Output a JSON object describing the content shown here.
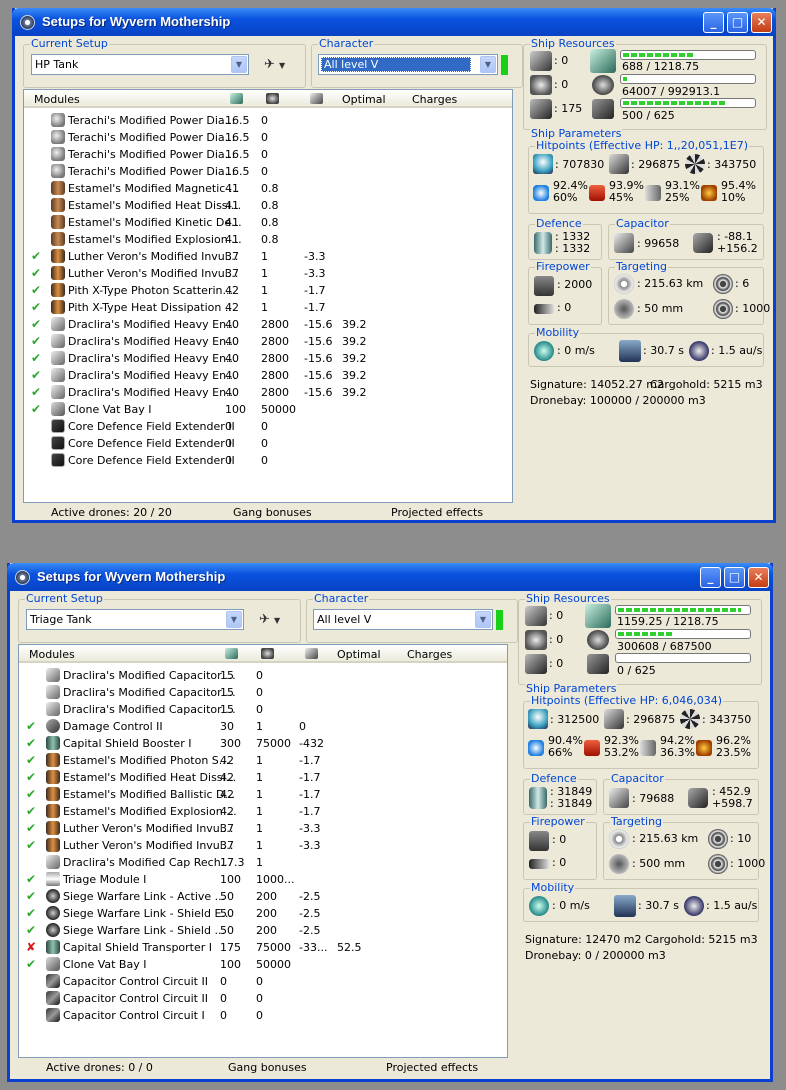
{
  "windows": [
    {
      "title": "Setups for Wyvern Mothership",
      "current_setup_label": "Current Setup",
      "current_setup": "HP Tank",
      "character_label": "Character",
      "character": "All level V",
      "character_highlight": true,
      "list_headers": {
        "modules": "Modules",
        "optimal": "Optimal",
        "charges": "Charges"
      },
      "modules": [
        {
          "check": "",
          "icon": "bay",
          "name": "Terachi's Modified Power Dia...",
          "c1": "16.5",
          "c2": "0",
          "c3": "",
          "c4": ""
        },
        {
          "check": "",
          "icon": "bay",
          "name": "Terachi's Modified Power Dia...",
          "c1": "16.5",
          "c2": "0",
          "c3": "",
          "c4": ""
        },
        {
          "check": "",
          "icon": "bay",
          "name": "Terachi's Modified Power Dia...",
          "c1": "16.5",
          "c2": "0",
          "c3": "",
          "c4": ""
        },
        {
          "check": "",
          "icon": "bay",
          "name": "Terachi's Modified Power Dia...",
          "c1": "16.5",
          "c2": "0",
          "c3": "",
          "c4": ""
        },
        {
          "check": "",
          "icon": "mag",
          "name": "Estamel's Modified Magnetic ...",
          "c1": "41",
          "c2": "0.8",
          "c3": "",
          "c4": ""
        },
        {
          "check": "",
          "icon": "mag",
          "name": "Estamel's Modified Heat Dissi...",
          "c1": "41",
          "c2": "0.8",
          "c3": "",
          "c4": ""
        },
        {
          "check": "",
          "icon": "mag",
          "name": "Estamel's Modified Kinetic De...",
          "c1": "41",
          "c2": "0.8",
          "c3": "",
          "c4": ""
        },
        {
          "check": "",
          "icon": "mag",
          "name": "Estamel's Modified Explosion ...",
          "c1": "41",
          "c2": "0.8",
          "c3": "",
          "c4": ""
        },
        {
          "check": "✔",
          "icon": "amp",
          "name": "Luther Veron's Modified Invul...",
          "c1": "37",
          "c2": "1",
          "c3": "-3.3",
          "c4": ""
        },
        {
          "check": "✔",
          "icon": "amp",
          "name": "Luther Veron's Modified Invul...",
          "c1": "37",
          "c2": "1",
          "c3": "-3.3",
          "c4": ""
        },
        {
          "check": "✔",
          "icon": "amp",
          "name": "Pith X-Type Photon Scatterin...",
          "c1": "42",
          "c2": "1",
          "c3": "-1.7",
          "c4": ""
        },
        {
          "check": "✔",
          "icon": "amp",
          "name": "Pith X-Type Heat Dissipation ...",
          "c1": "42",
          "c2": "1",
          "c3": "-1.7",
          "c4": ""
        },
        {
          "check": "✔",
          "icon": "cap",
          "name": "Draclira's Modified Heavy En...",
          "c1": "40",
          "c2": "2800",
          "c3": "-15.6",
          "c4": "39.2"
        },
        {
          "check": "✔",
          "icon": "cap",
          "name": "Draclira's Modified Heavy En...",
          "c1": "40",
          "c2": "2800",
          "c3": "-15.6",
          "c4": "39.2"
        },
        {
          "check": "✔",
          "icon": "cap",
          "name": "Draclira's Modified Heavy En...",
          "c1": "40",
          "c2": "2800",
          "c3": "-15.6",
          "c4": "39.2"
        },
        {
          "check": "✔",
          "icon": "cap",
          "name": "Draclira's Modified Heavy En...",
          "c1": "40",
          "c2": "2800",
          "c3": "-15.6",
          "c4": "39.2"
        },
        {
          "check": "✔",
          "icon": "cap",
          "name": "Draclira's Modified Heavy En...",
          "c1": "40",
          "c2": "2800",
          "c3": "-15.6",
          "c4": "39.2"
        },
        {
          "check": "✔",
          "icon": "vat",
          "name": "Clone Vat Bay I",
          "c1": "100",
          "c2": "50000",
          "c3": "",
          "c4": ""
        },
        {
          "check": "",
          "icon": "core",
          "name": "Core Defence Field Extender II",
          "c1": "0",
          "c2": "0",
          "c3": "",
          "c4": ""
        },
        {
          "check": "",
          "icon": "core",
          "name": "Core Defence Field Extender II",
          "c1": "0",
          "c2": "0",
          "c3": "",
          "c4": ""
        },
        {
          "check": "",
          "icon": "core",
          "name": "Core Defence Field Extender II",
          "c1": "0",
          "c2": "0",
          "c3": "",
          "c4": ""
        }
      ],
      "status": {
        "drones": "Active drones: 20 / 20",
        "gang": "Gang bonuses",
        "projected": "Projected effects"
      },
      "resources": {
        "label": "Ship Resources",
        "turrets": "0",
        "launchers": "0",
        "calibration": "175",
        "cpu_text": "688 / 1218.75",
        "cpu_fill": 0.56,
        "pg_text": "64007 / 992913.1",
        "pg_fill": 0.06,
        "drone_text": "500 / 625",
        "drone_fill": 0.8
      },
      "params_label": "Ship Parameters",
      "hitpoints": {
        "label": "Hitpoints (Effective HP: 1,,20,051,1E7)",
        "shield": ": 707830",
        "armor": ": 296875",
        "structure": ": 343750",
        "em": [
          "92.4%",
          "60%"
        ],
        "thermal": [
          "93.9%",
          "45%"
        ],
        "kinetic": [
          "93.1%",
          "25%"
        ],
        "explosive": [
          "95.4%",
          "10%"
        ]
      },
      "defence": {
        "label": "Defence",
        "v1": ": 1332",
        "v2": ": 1332"
      },
      "capacitor": {
        "label": "Capacitor",
        "amount": ": 99658",
        "rate1": ": -88.1",
        "rate2": "+156.2"
      },
      "firepower": {
        "label": "Firepower",
        "turret": ": 2000",
        "missile": ": 0"
      },
      "targeting": {
        "label": "Targeting",
        "range": ": 215.63 km",
        "targets": ": 6",
        "scan": ": 50 mm",
        "sensor": ": 1000"
      },
      "mobility": {
        "label": "Mobility",
        "speed": ": 0 m/s",
        "align": ": 30.7 s",
        "warp": ": 1.5 au/s"
      },
      "signature": "Signature: 14052.27 m2",
      "cargo": "Cargohold: 5215 m3",
      "dronebay": "Dronebay: 100000 / 200000 m3"
    },
    {
      "title": "Setups for Wyvern Mothership",
      "current_setup_label": "Current Setup",
      "current_setup": "Triage Tank",
      "character_label": "Character",
      "character": "All level V",
      "character_highlight": false,
      "list_headers": {
        "modules": "Modules",
        "optimal": "Optimal",
        "charges": "Charges"
      },
      "modules": [
        {
          "check": "",
          "icon": "cap",
          "name": "Draclira's Modified Capacitor ...",
          "c1": "15",
          "c2": "0",
          "c3": "",
          "c4": ""
        },
        {
          "check": "",
          "icon": "cap",
          "name": "Draclira's Modified Capacitor ...",
          "c1": "15",
          "c2": "0",
          "c3": "",
          "c4": ""
        },
        {
          "check": "",
          "icon": "cap",
          "name": "Draclira's Modified Capacitor ...",
          "c1": "15",
          "c2": "0",
          "c3": "",
          "c4": ""
        },
        {
          "check": "✔",
          "icon": "dc",
          "name": "Damage Control II",
          "c1": "30",
          "c2": "1",
          "c3": "0",
          "c4": ""
        },
        {
          "check": "✔",
          "icon": "shield",
          "name": "Capital Shield Booster I",
          "c1": "300",
          "c2": "75000",
          "c3": "-432",
          "c4": ""
        },
        {
          "check": "✔",
          "icon": "amp",
          "name": "Estamel's Modified Photon S...",
          "c1": "42",
          "c2": "1",
          "c3": "-1.7",
          "c4": ""
        },
        {
          "check": "✔",
          "icon": "amp",
          "name": "Estamel's Modified Heat Dissi...",
          "c1": "42",
          "c2": "1",
          "c3": "-1.7",
          "c4": ""
        },
        {
          "check": "✔",
          "icon": "amp",
          "name": "Estamel's Modified Ballistic D...",
          "c1": "42",
          "c2": "1",
          "c3": "-1.7",
          "c4": ""
        },
        {
          "check": "✔",
          "icon": "amp",
          "name": "Estamel's Modified Explosion ...",
          "c1": "42",
          "c2": "1",
          "c3": "-1.7",
          "c4": ""
        },
        {
          "check": "✔",
          "icon": "amp",
          "name": "Luther Veron's Modified Invul...",
          "c1": "37",
          "c2": "1",
          "c3": "-3.3",
          "c4": ""
        },
        {
          "check": "✔",
          "icon": "amp",
          "name": "Luther Veron's Modified Invul...",
          "c1": "37",
          "c2": "1",
          "c3": "-3.3",
          "c4": ""
        },
        {
          "check": "",
          "icon": "cap",
          "name": "Draclira's Modified Cap Rech...",
          "c1": "17.3",
          "c2": "1",
          "c3": "",
          "c4": ""
        },
        {
          "check": "✔",
          "icon": "triage",
          "name": "Triage Module I",
          "c1": "100",
          "c2": "1000...",
          "c3": "",
          "c4": ""
        },
        {
          "check": "✔",
          "icon": "link",
          "name": "Siege Warfare Link - Active ...",
          "c1": "50",
          "c2": "200",
          "c3": "-2.5",
          "c4": ""
        },
        {
          "check": "✔",
          "icon": "link",
          "name": "Siege Warfare Link - Shield E...",
          "c1": "50",
          "c2": "200",
          "c3": "-2.5",
          "c4": ""
        },
        {
          "check": "✔",
          "icon": "link",
          "name": "Siege Warfare Link - Shield ...",
          "c1": "50",
          "c2": "200",
          "c3": "-2.5",
          "c4": ""
        },
        {
          "check": "✘",
          "icon": "shield",
          "name": "Capital Shield Transporter I",
          "c1": "175",
          "c2": "75000",
          "c3": "-33...",
          "c4": "52.5"
        },
        {
          "check": "✔",
          "icon": "vat",
          "name": "Clone Vat Bay I",
          "c1": "100",
          "c2": "50000",
          "c3": "",
          "c4": ""
        },
        {
          "check": "",
          "icon": "ccc",
          "name": "Capacitor Control Circuit II",
          "c1": "0",
          "c2": "0",
          "c3": "",
          "c4": ""
        },
        {
          "check": "",
          "icon": "ccc",
          "name": "Capacitor Control Circuit II",
          "c1": "0",
          "c2": "0",
          "c3": "",
          "c4": ""
        },
        {
          "check": "",
          "icon": "ccc",
          "name": "Capacitor Control Circuit I",
          "c1": "0",
          "c2": "0",
          "c3": "",
          "c4": ""
        }
      ],
      "status": {
        "drones": "Active drones: 0 / 0",
        "gang": "Gang bonuses",
        "projected": "Projected effects"
      },
      "resources": {
        "label": "Ship Resources",
        "turrets": "0",
        "launchers": "0",
        "calibration": "0",
        "cpu_text": "1159.25 / 1218.75",
        "cpu_fill": 0.95,
        "pg_text": "300608 / 687500",
        "pg_fill": 0.44,
        "drone_text": "0 / 625",
        "drone_fill": 0
      },
      "params_label": "Ship Parameters",
      "hitpoints": {
        "label": "Hitpoints (Effective HP: 6,046,034)",
        "shield": ": 312500",
        "armor": ": 296875",
        "structure": ": 343750",
        "em": [
          "90.4%",
          "66%"
        ],
        "thermal": [
          "92.3%",
          "53.2%"
        ],
        "kinetic": [
          "94.2%",
          "36.3%"
        ],
        "explosive": [
          "96.2%",
          "23.5%"
        ]
      },
      "defence": {
        "label": "Defence",
        "v1": ": 31849",
        "v2": ": 31849"
      },
      "capacitor": {
        "label": "Capacitor",
        "amount": ": 79688",
        "rate1": ": 452.9",
        "rate2": "+598.7"
      },
      "firepower": {
        "label": "Firepower",
        "turret": ": 0",
        "missile": ": 0"
      },
      "targeting": {
        "label": "Targeting",
        "range": ": 215.63 km",
        "targets": ": 10",
        "scan": ": 500 mm",
        "sensor": ": 1000"
      },
      "mobility": {
        "label": "Mobility",
        "speed": ": 0 m/s",
        "align": ": 30.7 s",
        "warp": ": 1.5 au/s"
      },
      "signature": "Signature: 12470 m2",
      "cargo": "Cargohold: 5215 m3",
      "dronebay": "Dronebay: 0 / 200000 m3"
    }
  ]
}
